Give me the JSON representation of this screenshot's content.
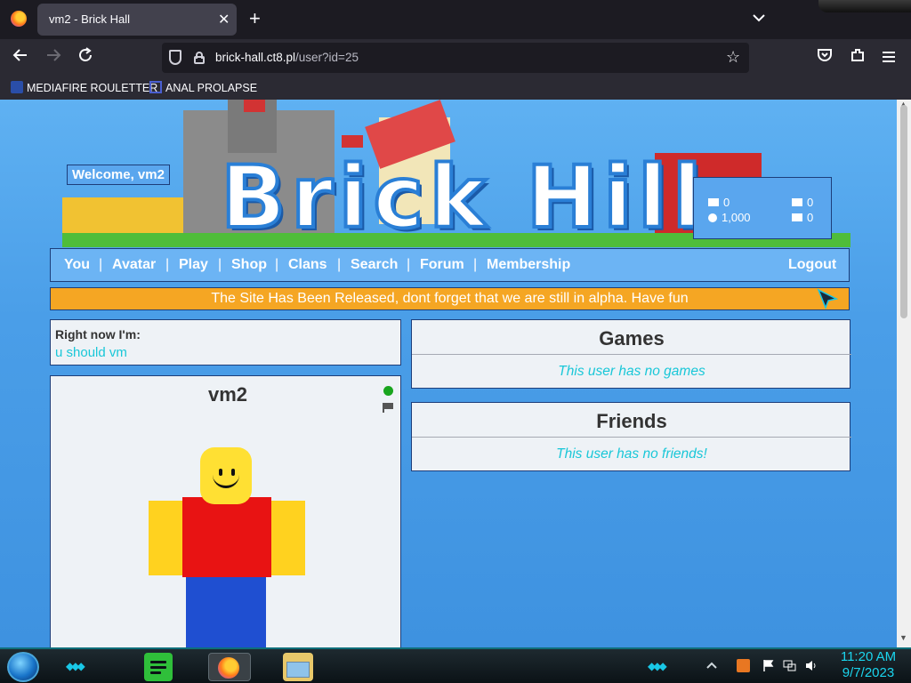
{
  "browser": {
    "tab_title": "vm2 - Brick Hall",
    "tab_close": "✕",
    "new_tab": "+",
    "tab_list": "⌵",
    "url_host": "brick-hall.ct8.pl",
    "url_path": "/user?id=25",
    "bookmarks": [
      {
        "label": "MEDIAFIRE ROULETTER"
      },
      {
        "label": "ANAL PROLAPSE"
      }
    ]
  },
  "site": {
    "logo_text": "Brick Hill",
    "welcome": "Welcome, vm2",
    "currency": {
      "bucks": "0",
      "bits": "1,000",
      "messages": "0",
      "friend_requests": "0"
    },
    "nav": {
      "you": "You",
      "avatar": "Avatar",
      "play": "Play",
      "shop": "Shop",
      "clans": "Clans",
      "search": "Search",
      "forum": "Forum",
      "membership": "Membership",
      "logout": "Logout",
      "separator": "|"
    },
    "alert": "The Site Has Been Released, dont forget that we are still in alpha. Have fun"
  },
  "profile": {
    "status_label": "Right now I'm:",
    "status_value": "u should vm",
    "username": "vm2",
    "online": true,
    "games_title": "Games",
    "games_empty": "This user has no games",
    "friends_title": "Friends",
    "friends_empty": "This user has no friends!"
  },
  "taskbar": {
    "time": "11:20 AM",
    "date": "9/7/2023"
  },
  "colors": {
    "page_bg": "#4a9ee8",
    "nav_bg": "#6cb4f4",
    "alert_bg": "#f5a623",
    "accent_text": "#19c7d8",
    "online": "#19a51e"
  }
}
